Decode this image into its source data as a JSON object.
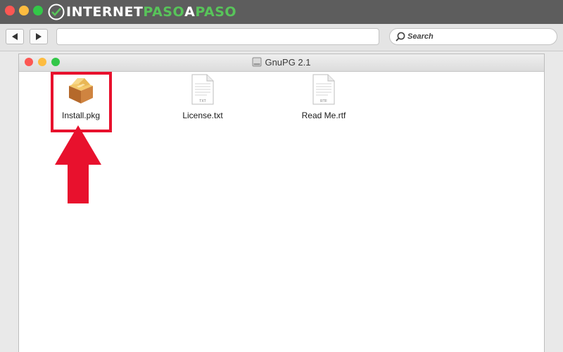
{
  "brand": {
    "logo_text_white_1": "INTERNET",
    "logo_text_green_1": "PASO",
    "logo_text_white_2": "A",
    "logo_text_green_2": "PASO"
  },
  "toolbar": {
    "search_label": "Search",
    "back_icon": "back-arrow-icon",
    "forward_icon": "forward-arrow-icon"
  },
  "finder": {
    "title": "GnuPG 2.1",
    "files": [
      {
        "name": "Install.pkg",
        "icon": "package-icon",
        "highlighted": true
      },
      {
        "name": "License.txt",
        "icon": "text-document-icon",
        "badge": "TXT"
      },
      {
        "name": "Read Me.rtf",
        "icon": "rtf-document-icon",
        "badge": "RTF"
      }
    ]
  },
  "colors": {
    "highlight": "#e8112d",
    "brand_green": "#58c45a",
    "titlebar": "#5d5d5d"
  }
}
